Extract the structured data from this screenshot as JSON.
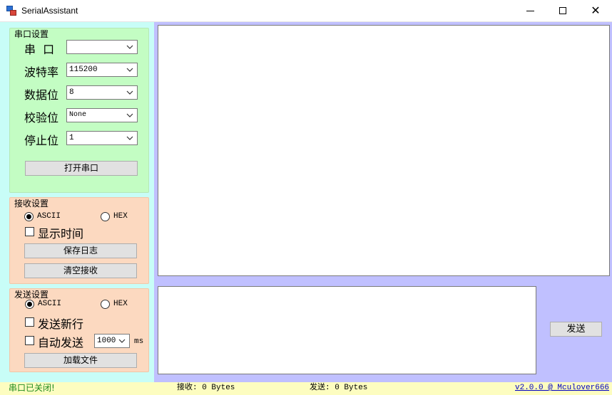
{
  "window": {
    "title": "SerialAssistant",
    "minimize": "—",
    "maximize": "☐",
    "close": "✕"
  },
  "serial_settings": {
    "title": "串口设置",
    "port_label": "串  口",
    "port_value": "",
    "baud_label": "波特率",
    "baud_value": "115200",
    "databits_label": "数据位",
    "databits_value": "8",
    "parity_label": "校验位",
    "parity_value": "None",
    "stopbits_label": "停止位",
    "stopbits_value": "1",
    "open_button": "打开串口"
  },
  "receive_settings": {
    "title": "接收设置",
    "ascii_label": "ASCII",
    "hex_label": "HEX",
    "selected_mode": "ASCII",
    "show_time_label": "显示时间",
    "show_time_checked": false,
    "save_log_button": "保存日志",
    "clear_button": "清空接收"
  },
  "send_settings": {
    "title": "发送设置",
    "ascii_label": "ASCII",
    "hex_label": "HEX",
    "selected_mode": "ASCII",
    "newline_label": "发送新行",
    "newline_checked": false,
    "auto_send_label": "自动发送",
    "auto_send_checked": false,
    "interval_value": "1000",
    "interval_unit": "ms",
    "load_file_button": "加载文件"
  },
  "main": {
    "receive_text": "",
    "send_text": "",
    "send_button": "发送"
  },
  "status": {
    "port_state": "串口已关闭!",
    "received": "接收: 0 Bytes",
    "sent": "发送: 0 Bytes",
    "version": "v2.0.0 @ Mculover666"
  },
  "colors": {
    "left_pane": "#c8fdf7",
    "right_pane": "#c0c0ff",
    "serial_group": "#c3fdc3",
    "receive_group": "#fcd9c0",
    "send_group": "#fcd9c0",
    "status_bar": "#fdfdc0",
    "status_ok": "#1f8a1f",
    "version_link": "#0000c0"
  },
  "icons": {
    "app": "app-icon",
    "dropdown": "chevron-down-icon"
  }
}
